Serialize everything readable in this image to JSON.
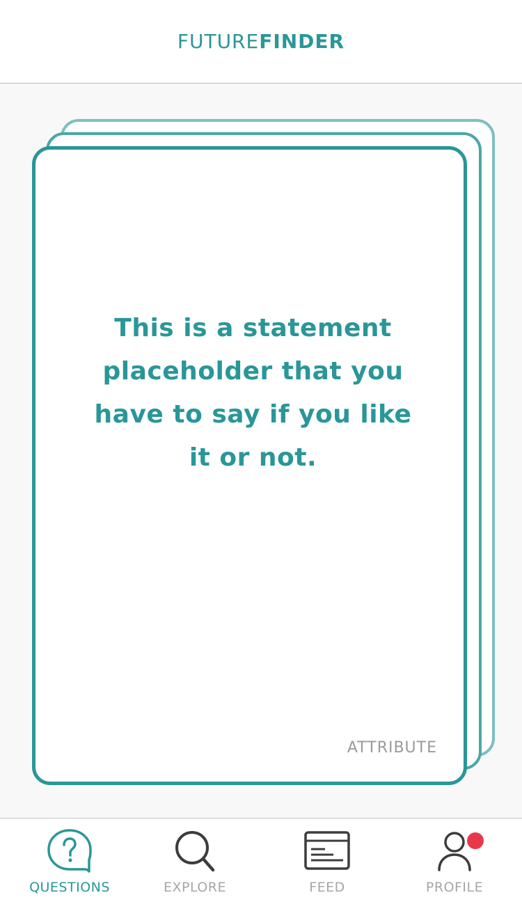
{
  "header": {
    "logo_light": "FUTURE",
    "logo_bold": "FINDER"
  },
  "card": {
    "statement": "This is a statement placeholder that you have to say if you like it or not.",
    "attribute": "ATTRIBUTE"
  },
  "tabbar": {
    "items": [
      {
        "label": "QUESTIONS",
        "icon": "question-bubble-icon",
        "active": true
      },
      {
        "label": "EXPLORE",
        "icon": "search-icon",
        "active": false
      },
      {
        "label": "FEED",
        "icon": "feed-icon",
        "active": false
      },
      {
        "label": "PROFILE",
        "icon": "user-icon",
        "active": false,
        "badge": true
      }
    ]
  },
  "colors": {
    "accent": "#2a9698",
    "inactive": "#a6a6a6",
    "badge": "#e8384a"
  }
}
